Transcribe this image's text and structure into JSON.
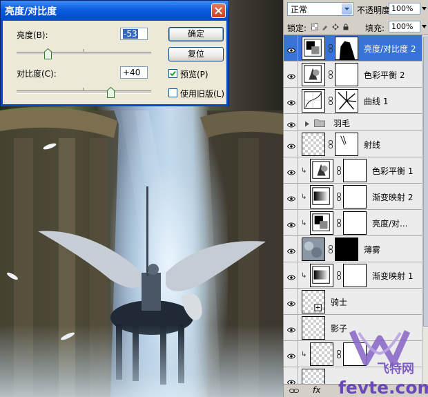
{
  "dialog": {
    "title": "亮度/对比度",
    "brightness_label": "亮度(B):",
    "brightness_value": "-53",
    "brightness_level": -53,
    "contrast_label": "对比度(C):",
    "contrast_value": "+40",
    "contrast_level": 40,
    "ok_label": "确定",
    "reset_label": "复位",
    "preview_label": "预览(P)",
    "preview_checked": true,
    "legacy_label": "使用旧版(L)",
    "legacy_checked": false
  },
  "layers_panel": {
    "blend_mode": "正常",
    "opacity_label": "不透明度:",
    "opacity_value": "100%",
    "lock_label": "锁定:",
    "fill_label": "填充:",
    "fill_value": "100%",
    "layers": [
      {
        "name": "亮度/对比度 2",
        "selected": true,
        "thumb": "adjust-brightness-icon",
        "mask": "figure-mask"
      },
      {
        "name": "色彩平衡 2",
        "thumb": "color-balance-icon",
        "mask": "white-mask"
      },
      {
        "name": "曲线 1",
        "thumb": "curves-icon",
        "mask": "rays-mask"
      },
      {
        "name": "羽毛",
        "group": true
      },
      {
        "name": "射线",
        "thumb": "transparent",
        "mask": "small-rays-mask"
      },
      {
        "name": "色彩平衡 1",
        "clipped": true,
        "thumb": "color-balance-icon",
        "mask": "white-mask"
      },
      {
        "name": "渐变映射 2",
        "clipped": true,
        "thumb": "gradient-map-icon",
        "mask": "white-mask"
      },
      {
        "name": "亮度/对...",
        "clipped": true,
        "thumb": "adjust-brightness-icon",
        "mask": "white-mask"
      },
      {
        "name": "薄雾",
        "thumb": "clouds-image",
        "mask": "black-mask"
      },
      {
        "name": "渐变映射 1",
        "clipped": true,
        "thumb": "gradient-map-icon",
        "mask": "white-mask"
      },
      {
        "name": "骑士",
        "thumb": "transparent-smart"
      },
      {
        "name": "影子",
        "thumb": "transparent"
      },
      {
        "name": "",
        "clipped": true,
        "thumb": "transparent",
        "mask": "white-mask"
      },
      {
        "name": "",
        "thumb": "transparent"
      }
    ]
  },
  "watermark": {
    "text": "fevte.com",
    "cn_text": "飞特网"
  }
}
